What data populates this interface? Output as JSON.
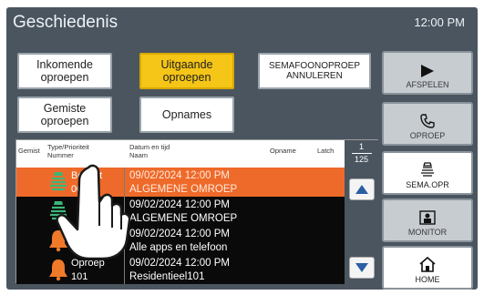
{
  "header": {
    "title": "Geschiedenis",
    "clock": "12:00 PM"
  },
  "tabs": {
    "incoming": "Inkomende\noproepen",
    "outgoing": "Uitgaande\noproepen",
    "cancel_sema": "SEMAFOONOPROEP\nANNULEREN",
    "missed": "Gemiste\noproepen",
    "recordings": "Opnames"
  },
  "table": {
    "headers": {
      "gemist": "Gemist",
      "type": "Type/Prioriteit\nNummer",
      "date": "Datum en tijd\nNaam",
      "opname": "Opname",
      "latch": "Latch"
    },
    "rows": [
      {
        "icon": "paging-icon",
        "type": "Bericht\n001",
        "date": "09/02/2024 12:00 PM",
        "name": "ALGEMENE OMROEP",
        "selected": true
      },
      {
        "icon": "paging-icon",
        "type": "\n",
        "date": "09/02/2024 12:00 PM",
        "name": "ALGEMENE OMROEP",
        "selected": false
      },
      {
        "icon": "bell-icon",
        "type": "Oproep\n201",
        "date": "09/02/2024 12:00 PM",
        "name": "Alle apps en telefoon",
        "selected": false
      },
      {
        "icon": "bell-icon",
        "type": "Oproep\n101",
        "date": "09/02/2024 12:00 PM",
        "name": "Residentieel101",
        "selected": false
      }
    ],
    "page": {
      "current": "1",
      "total": "125"
    }
  },
  "side_buttons": {
    "play": "AFSPELEN",
    "call": "OPROEP",
    "sema": "SEMA.OPR",
    "monitor": "MONITOR",
    "home": "HOME"
  },
  "colors": {
    "selected_row": "#ee6a2a",
    "active_tab": "#f5c518",
    "background": "#4a5560"
  }
}
